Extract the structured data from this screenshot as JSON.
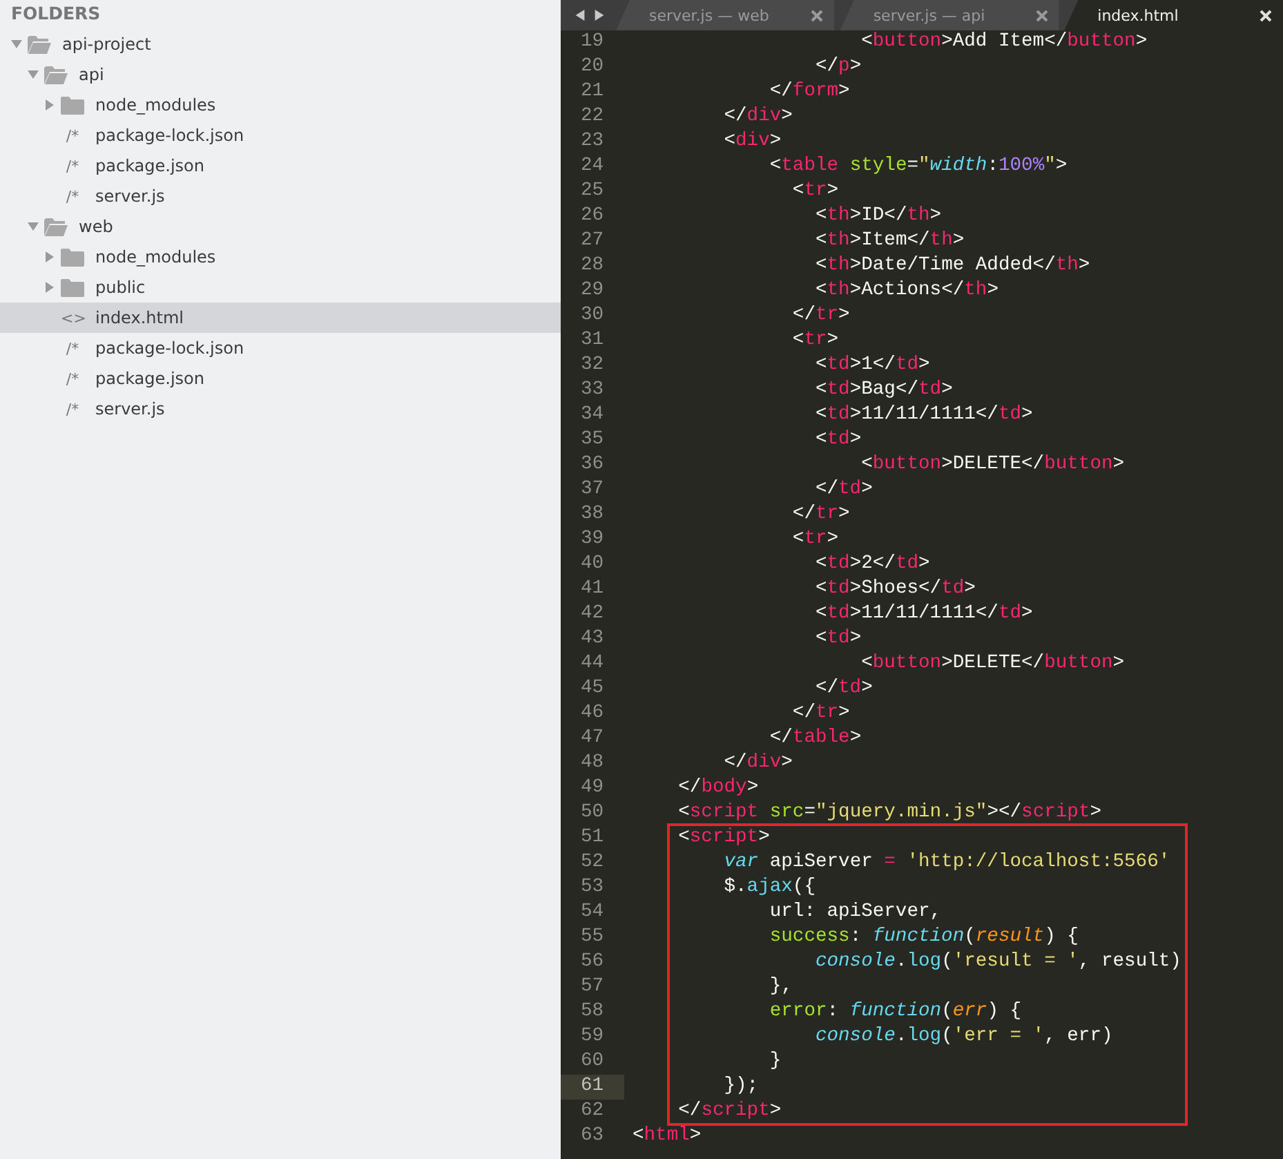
{
  "sidebar": {
    "title": "FOLDERS",
    "tree": [
      {
        "name": "api-project",
        "kind": "folder",
        "expanded": true,
        "selected": false,
        "children": [
          {
            "name": "api",
            "kind": "folder",
            "expanded": true,
            "selected": false,
            "children": [
              {
                "name": "node_modules",
                "kind": "folder",
                "expanded": false,
                "selected": false
              },
              {
                "name": "package-lock.json",
                "kind": "file",
                "icon": "/*",
                "selected": false
              },
              {
                "name": "package.json",
                "kind": "file",
                "icon": "/*",
                "selected": false
              },
              {
                "name": "server.js",
                "kind": "file",
                "icon": "/*",
                "selected": false
              }
            ]
          },
          {
            "name": "web",
            "kind": "folder",
            "expanded": true,
            "selected": false,
            "children": [
              {
                "name": "node_modules",
                "kind": "folder",
                "expanded": false,
                "selected": false
              },
              {
                "name": "public",
                "kind": "folder",
                "expanded": false,
                "selected": false
              },
              {
                "name": "index.html",
                "kind": "file",
                "icon": "<>",
                "selected": true
              },
              {
                "name": "package-lock.json",
                "kind": "file",
                "icon": "/*",
                "selected": false
              },
              {
                "name": "package.json",
                "kind": "file",
                "icon": "/*",
                "selected": false
              },
              {
                "name": "server.js",
                "kind": "file",
                "icon": "/*",
                "selected": false
              }
            ]
          }
        ]
      }
    ]
  },
  "tabs": [
    {
      "label": "server.js — web",
      "selected": false
    },
    {
      "label": "server.js — api",
      "selected": false
    },
    {
      "label": "index.html",
      "selected": true
    }
  ],
  "editor": {
    "lines": [
      {
        "number": "19",
        "current": false,
        "highlighted": false,
        "tokens": [
          {
            "kind": "plain",
            "text": "                    <"
          },
          {
            "kind": "tag",
            "text": "button"
          },
          {
            "kind": "plain",
            "text": ">Add Item</"
          },
          {
            "kind": "tag",
            "text": "button"
          },
          {
            "kind": "plain",
            "text": ">"
          }
        ]
      },
      {
        "number": "20",
        "current": false,
        "highlighted": false,
        "tokens": [
          {
            "kind": "plain",
            "text": "                </"
          },
          {
            "kind": "tag",
            "text": "p"
          },
          {
            "kind": "plain",
            "text": ">"
          }
        ]
      },
      {
        "number": "21",
        "current": false,
        "highlighted": false,
        "tokens": [
          {
            "kind": "plain",
            "text": "            </"
          },
          {
            "kind": "tag",
            "text": "form"
          },
          {
            "kind": "plain",
            "text": ">"
          }
        ]
      },
      {
        "number": "22",
        "current": false,
        "highlighted": false,
        "tokens": [
          {
            "kind": "plain",
            "text": "        </"
          },
          {
            "kind": "tag",
            "text": "div"
          },
          {
            "kind": "plain",
            "text": ">"
          }
        ]
      },
      {
        "number": "23",
        "current": false,
        "highlighted": false,
        "tokens": [
          {
            "kind": "plain",
            "text": "        <"
          },
          {
            "kind": "tag",
            "text": "div"
          },
          {
            "kind": "plain",
            "text": ">"
          }
        ]
      },
      {
        "number": "24",
        "current": false,
        "highlighted": false,
        "tokens": [
          {
            "kind": "plain",
            "text": "            <"
          },
          {
            "kind": "tag",
            "text": "table"
          },
          {
            "kind": "attr",
            "text": " style"
          },
          {
            "kind": "plain",
            "text": "="
          },
          {
            "kind": "string",
            "text": "\""
          },
          {
            "kind": "property",
            "text": "width"
          },
          {
            "kind": "plain",
            "text": ":"
          },
          {
            "kind": "number",
            "text": "100%"
          },
          {
            "kind": "string",
            "text": "\""
          },
          {
            "kind": "plain",
            "text": ">"
          }
        ]
      },
      {
        "number": "25",
        "current": false,
        "highlighted": false,
        "tokens": [
          {
            "kind": "plain",
            "text": "              <"
          },
          {
            "kind": "tag",
            "text": "tr"
          },
          {
            "kind": "plain",
            "text": ">"
          }
        ]
      },
      {
        "number": "26",
        "current": false,
        "highlighted": false,
        "tokens": [
          {
            "kind": "plain",
            "text": "                <"
          },
          {
            "kind": "tag",
            "text": "th"
          },
          {
            "kind": "plain",
            "text": ">ID</"
          },
          {
            "kind": "tag",
            "text": "th"
          },
          {
            "kind": "plain",
            "text": ">"
          }
        ]
      },
      {
        "number": "27",
        "current": false,
        "highlighted": false,
        "tokens": [
          {
            "kind": "plain",
            "text": "                <"
          },
          {
            "kind": "tag",
            "text": "th"
          },
          {
            "kind": "plain",
            "text": ">Item</"
          },
          {
            "kind": "tag",
            "text": "th"
          },
          {
            "kind": "plain",
            "text": ">"
          }
        ]
      },
      {
        "number": "28",
        "current": false,
        "highlighted": false,
        "tokens": [
          {
            "kind": "plain",
            "text": "                <"
          },
          {
            "kind": "tag",
            "text": "th"
          },
          {
            "kind": "plain",
            "text": ">Date/Time Added</"
          },
          {
            "kind": "tag",
            "text": "th"
          },
          {
            "kind": "plain",
            "text": ">"
          }
        ]
      },
      {
        "number": "29",
        "current": false,
        "highlighted": false,
        "tokens": [
          {
            "kind": "plain",
            "text": "                <"
          },
          {
            "kind": "tag",
            "text": "th"
          },
          {
            "kind": "plain",
            "text": ">Actions</"
          },
          {
            "kind": "tag",
            "text": "th"
          },
          {
            "kind": "plain",
            "text": ">"
          }
        ]
      },
      {
        "number": "30",
        "current": false,
        "highlighted": false,
        "tokens": [
          {
            "kind": "plain",
            "text": "              </"
          },
          {
            "kind": "tag",
            "text": "tr"
          },
          {
            "kind": "plain",
            "text": ">"
          }
        ]
      },
      {
        "number": "31",
        "current": false,
        "highlighted": false,
        "tokens": [
          {
            "kind": "plain",
            "text": "              <"
          },
          {
            "kind": "tag",
            "text": "tr"
          },
          {
            "kind": "plain",
            "text": ">"
          }
        ]
      },
      {
        "number": "32",
        "current": false,
        "highlighted": false,
        "tokens": [
          {
            "kind": "plain",
            "text": "                <"
          },
          {
            "kind": "tag",
            "text": "td"
          },
          {
            "kind": "plain",
            "text": ">1</"
          },
          {
            "kind": "tag",
            "text": "td"
          },
          {
            "kind": "plain",
            "text": ">"
          }
        ]
      },
      {
        "number": "33",
        "current": false,
        "highlighted": false,
        "tokens": [
          {
            "kind": "plain",
            "text": "                <"
          },
          {
            "kind": "tag",
            "text": "td"
          },
          {
            "kind": "plain",
            "text": ">Bag</"
          },
          {
            "kind": "tag",
            "text": "td"
          },
          {
            "kind": "plain",
            "text": ">"
          }
        ]
      },
      {
        "number": "34",
        "current": false,
        "highlighted": false,
        "tokens": [
          {
            "kind": "plain",
            "text": "                <"
          },
          {
            "kind": "tag",
            "text": "td"
          },
          {
            "kind": "plain",
            "text": ">11/11/1111</"
          },
          {
            "kind": "tag",
            "text": "td"
          },
          {
            "kind": "plain",
            "text": ">"
          }
        ]
      },
      {
        "number": "35",
        "current": false,
        "highlighted": false,
        "tokens": [
          {
            "kind": "plain",
            "text": "                <"
          },
          {
            "kind": "tag",
            "text": "td"
          },
          {
            "kind": "plain",
            "text": ">"
          }
        ]
      },
      {
        "number": "36",
        "current": false,
        "highlighted": false,
        "tokens": [
          {
            "kind": "plain",
            "text": "                    <"
          },
          {
            "kind": "tag",
            "text": "button"
          },
          {
            "kind": "plain",
            "text": ">DELETE</"
          },
          {
            "kind": "tag",
            "text": "button"
          },
          {
            "kind": "plain",
            "text": ">"
          }
        ]
      },
      {
        "number": "37",
        "current": false,
        "highlighted": false,
        "tokens": [
          {
            "kind": "plain",
            "text": "                </"
          },
          {
            "kind": "tag",
            "text": "td"
          },
          {
            "kind": "plain",
            "text": ">"
          }
        ]
      },
      {
        "number": "38",
        "current": false,
        "highlighted": false,
        "tokens": [
          {
            "kind": "plain",
            "text": "              </"
          },
          {
            "kind": "tag",
            "text": "tr"
          },
          {
            "kind": "plain",
            "text": ">"
          }
        ]
      },
      {
        "number": "39",
        "current": false,
        "highlighted": false,
        "tokens": [
          {
            "kind": "plain",
            "text": "              <"
          },
          {
            "kind": "tag",
            "text": "tr"
          },
          {
            "kind": "plain",
            "text": ">"
          }
        ]
      },
      {
        "number": "40",
        "current": false,
        "highlighted": false,
        "tokens": [
          {
            "kind": "plain",
            "text": "                <"
          },
          {
            "kind": "tag",
            "text": "td"
          },
          {
            "kind": "plain",
            "text": ">2</"
          },
          {
            "kind": "tag",
            "text": "td"
          },
          {
            "kind": "plain",
            "text": ">"
          }
        ]
      },
      {
        "number": "41",
        "current": false,
        "highlighted": false,
        "tokens": [
          {
            "kind": "plain",
            "text": "                <"
          },
          {
            "kind": "tag",
            "text": "td"
          },
          {
            "kind": "plain",
            "text": ">Shoes</"
          },
          {
            "kind": "tag",
            "text": "td"
          },
          {
            "kind": "plain",
            "text": ">"
          }
        ]
      },
      {
        "number": "42",
        "current": false,
        "highlighted": false,
        "tokens": [
          {
            "kind": "plain",
            "text": "                <"
          },
          {
            "kind": "tag",
            "text": "td"
          },
          {
            "kind": "plain",
            "text": ">11/11/1111</"
          },
          {
            "kind": "tag",
            "text": "td"
          },
          {
            "kind": "plain",
            "text": ">"
          }
        ]
      },
      {
        "number": "43",
        "current": false,
        "highlighted": false,
        "tokens": [
          {
            "kind": "plain",
            "text": "                <"
          },
          {
            "kind": "tag",
            "text": "td"
          },
          {
            "kind": "plain",
            "text": ">"
          }
        ]
      },
      {
        "number": "44",
        "current": false,
        "highlighted": false,
        "tokens": [
          {
            "kind": "plain",
            "text": "                    <"
          },
          {
            "kind": "tag",
            "text": "button"
          },
          {
            "kind": "plain",
            "text": ">DELETE</"
          },
          {
            "kind": "tag",
            "text": "button"
          },
          {
            "kind": "plain",
            "text": ">"
          }
        ]
      },
      {
        "number": "45",
        "current": false,
        "highlighted": false,
        "tokens": [
          {
            "kind": "plain",
            "text": "                </"
          },
          {
            "kind": "tag",
            "text": "td"
          },
          {
            "kind": "plain",
            "text": ">"
          }
        ]
      },
      {
        "number": "46",
        "current": false,
        "highlighted": false,
        "tokens": [
          {
            "kind": "plain",
            "text": "              </"
          },
          {
            "kind": "tag",
            "text": "tr"
          },
          {
            "kind": "plain",
            "text": ">"
          }
        ]
      },
      {
        "number": "47",
        "current": false,
        "highlighted": false,
        "tokens": [
          {
            "kind": "plain",
            "text": "            </"
          },
          {
            "kind": "tag",
            "text": "table"
          },
          {
            "kind": "plain",
            "text": ">"
          }
        ]
      },
      {
        "number": "48",
        "current": false,
        "highlighted": false,
        "tokens": [
          {
            "kind": "plain",
            "text": "        </"
          },
          {
            "kind": "tag",
            "text": "div"
          },
          {
            "kind": "plain",
            "text": ">"
          }
        ]
      },
      {
        "number": "49",
        "current": false,
        "highlighted": false,
        "tokens": [
          {
            "kind": "plain",
            "text": "    </"
          },
          {
            "kind": "tag",
            "text": "body"
          },
          {
            "kind": "plain",
            "text": ">"
          }
        ]
      },
      {
        "number": "50",
        "current": false,
        "highlighted": false,
        "tokens": [
          {
            "kind": "plain",
            "text": "    <"
          },
          {
            "kind": "tag",
            "text": "script"
          },
          {
            "kind": "attr",
            "text": " src"
          },
          {
            "kind": "plain",
            "text": "="
          },
          {
            "kind": "string",
            "text": "\"jquery.min.js\""
          },
          {
            "kind": "plain",
            "text": "></"
          },
          {
            "kind": "tag",
            "text": "script"
          },
          {
            "kind": "plain",
            "text": ">"
          }
        ]
      },
      {
        "number": "51",
        "current": false,
        "highlighted": true,
        "tokens": [
          {
            "kind": "plain",
            "text": "    <"
          },
          {
            "kind": "tag",
            "text": "script"
          },
          {
            "kind": "plain",
            "text": ">"
          }
        ]
      },
      {
        "number": "52",
        "current": false,
        "highlighted": true,
        "tokens": [
          {
            "kind": "keyword",
            "text": "        var"
          },
          {
            "kind": "plain",
            "text": " apiServer "
          },
          {
            "kind": "operator",
            "text": "="
          },
          {
            "kind": "string",
            "text": " 'http://localhost:5566'"
          }
        ]
      },
      {
        "number": "53",
        "current": false,
        "highlighted": true,
        "tokens": [
          {
            "kind": "plain",
            "text": "        $."
          },
          {
            "kind": "function",
            "text": "ajax"
          },
          {
            "kind": "plain",
            "text": "({"
          }
        ]
      },
      {
        "number": "54",
        "current": false,
        "highlighted": true,
        "tokens": [
          {
            "kind": "plain",
            "text": "            url: apiServer,"
          }
        ]
      },
      {
        "number": "55",
        "current": false,
        "highlighted": true,
        "tokens": [
          {
            "kind": "key",
            "text": "            success"
          },
          {
            "kind": "plain",
            "text": ": "
          },
          {
            "kind": "keyword",
            "text": "function"
          },
          {
            "kind": "plain",
            "text": "("
          },
          {
            "kind": "param",
            "text": "result"
          },
          {
            "kind": "plain",
            "text": ") {"
          }
        ]
      },
      {
        "number": "56",
        "current": false,
        "highlighted": true,
        "tokens": [
          {
            "kind": "keyword",
            "text": "                console"
          },
          {
            "kind": "plain",
            "text": "."
          },
          {
            "kind": "function",
            "text": "log"
          },
          {
            "kind": "plain",
            "text": "("
          },
          {
            "kind": "string",
            "text": "'result = '"
          },
          {
            "kind": "plain",
            "text": ", result)"
          }
        ]
      },
      {
        "number": "57",
        "current": false,
        "highlighted": true,
        "tokens": [
          {
            "kind": "plain",
            "text": "            },"
          }
        ]
      },
      {
        "number": "58",
        "current": false,
        "highlighted": true,
        "tokens": [
          {
            "kind": "key",
            "text": "            error"
          },
          {
            "kind": "plain",
            "text": ": "
          },
          {
            "kind": "keyword",
            "text": "function"
          },
          {
            "kind": "plain",
            "text": "("
          },
          {
            "kind": "param",
            "text": "err"
          },
          {
            "kind": "plain",
            "text": ") {"
          }
        ]
      },
      {
        "number": "59",
        "current": false,
        "highlighted": true,
        "tokens": [
          {
            "kind": "keyword",
            "text": "                console"
          },
          {
            "kind": "plain",
            "text": "."
          },
          {
            "kind": "function",
            "text": "log"
          },
          {
            "kind": "plain",
            "text": "("
          },
          {
            "kind": "string",
            "text": "'err = '"
          },
          {
            "kind": "plain",
            "text": ", err)"
          }
        ]
      },
      {
        "number": "60",
        "current": false,
        "highlighted": true,
        "tokens": [
          {
            "kind": "plain",
            "text": "            }"
          }
        ]
      },
      {
        "number": "61",
        "current": true,
        "highlighted": true,
        "tokens": [
          {
            "kind": "plain",
            "text": "        });"
          }
        ]
      },
      {
        "number": "62",
        "current": false,
        "highlighted": true,
        "tokens": [
          {
            "kind": "plain",
            "text": "    </"
          },
          {
            "kind": "tag",
            "text": "script"
          },
          {
            "kind": "plain",
            "text": ">"
          }
        ]
      },
      {
        "number": "63",
        "current": false,
        "highlighted": false,
        "tokens": [
          {
            "kind": "plain",
            "text": "<"
          },
          {
            "kind": "tag",
            "text": "html"
          },
          {
            "kind": "plain",
            "text": ">"
          }
        ]
      }
    ]
  }
}
